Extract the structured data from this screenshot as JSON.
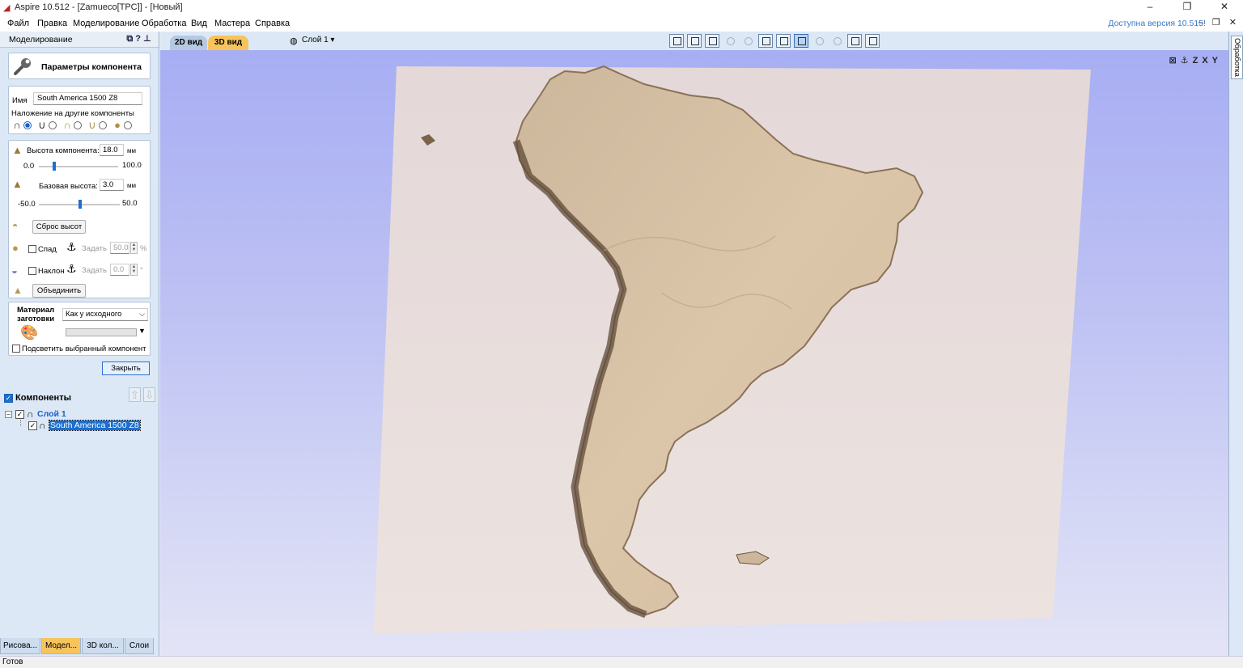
{
  "window": {
    "title": "Aspire 10.512 - [Zamueco[TPC]] - [Новый]",
    "minimize": "–",
    "maximize": "❐",
    "close": "✕"
  },
  "menu": {
    "items": [
      "Файл",
      "Правка",
      "Моделирование",
      "Обработка",
      "Вид",
      "Мастера",
      "Справка"
    ],
    "update_notice": "Доступна версия 10.515!",
    "mini_controls": "– ❐ ✕"
  },
  "left_panel": {
    "header": "Моделирование",
    "header_icons": "⧉?⊥",
    "component_params_label": "Параметры компонента",
    "name_label": "Имя",
    "name_value": "South America 1500 Z8",
    "overlap_label": "Наложение на другие компоненты",
    "height_label": "Высота компонента:",
    "height_value": "18.0",
    "height_unit": "мм",
    "height_min": "0.0",
    "height_max": "100.0",
    "base_label": "Базовая высота:",
    "base_value": "3.0",
    "base_unit": "мм",
    "base_min": "-50.0",
    "base_max": "50.0",
    "reset_button": "Сброс высот",
    "fade_label": "Спад",
    "fade_set": "Задать",
    "fade_value": "50.0",
    "fade_unit": "%",
    "tilt_label": "Наклон",
    "tilt_set": "Задать",
    "tilt_value": "0.0",
    "tilt_unit": "°",
    "merge_button": "Объединить",
    "material_label_1": "Материал",
    "material_label_2": "заготовки",
    "material_select": "Как у исходного",
    "highlight_label": "Подсветить выбранный компонент",
    "close_button": "Закрыть",
    "components_header": "Компоненты",
    "tree": {
      "layer": "Слой 1",
      "component": "South America 1500 Z8"
    },
    "bottom_tabs": [
      "Рисова...",
      "Модел...",
      "3D кол...",
      "Слои"
    ]
  },
  "view_tabs": {
    "tab_2d": "2D вид",
    "tab_3d": "3D вид",
    "layer_select": "Слой 1 ▾"
  },
  "right_tab": "Обработка",
  "viewport_icons": "⊠⚓ZXY",
  "status": "Готов"
}
